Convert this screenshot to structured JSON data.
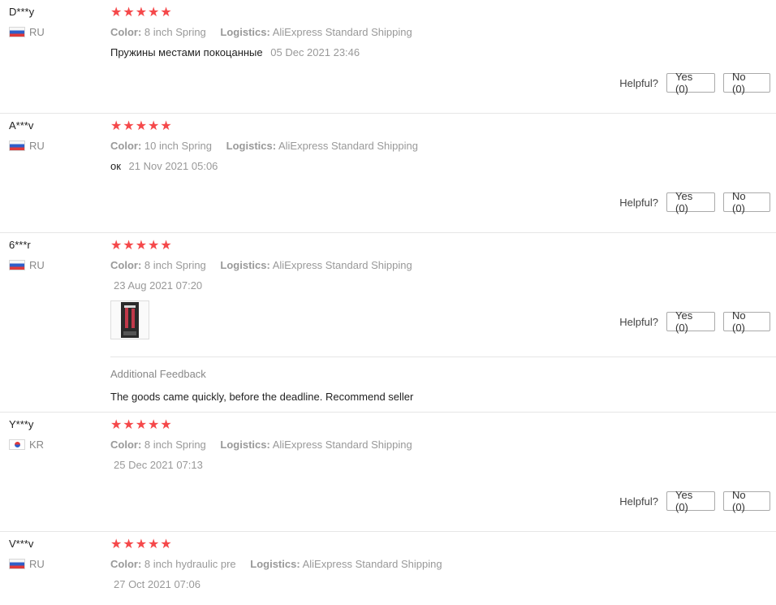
{
  "colors": {
    "star": "#f5484a",
    "divider": "#e6e6e6",
    "muted": "#999999"
  },
  "helpful_label": "Helpful?",
  "color_key": "Color:",
  "logistics_key": "Logistics:",
  "additional_title": "Additional Feedback",
  "reviews": [
    {
      "name": "D***y",
      "country": "RU",
      "rating": 5,
      "color": "8 inch Spring",
      "logistics": "AliExpress Standard Shipping",
      "text": "Пружины местами покоцанные",
      "date": "05 Dec 2021 23:46",
      "yes": "Yes (0)",
      "no": "No (0)"
    },
    {
      "name": "A***v",
      "country": "RU",
      "rating": 5,
      "color": "10 inch Spring",
      "logistics": "AliExpress Standard Shipping",
      "text": "ок",
      "date": "21 Nov 2021 05:06",
      "yes": "Yes (0)",
      "no": "No (0)"
    },
    {
      "name": "6***r",
      "country": "RU",
      "rating": 5,
      "color": "8 inch Spring",
      "logistics": "AliExpress Standard Shipping",
      "text": "",
      "date": "23 Aug 2021 07:20",
      "yes": "Yes (0)",
      "no": "No (0)",
      "additional": "The goods came quickly, before the deadline. Recommend seller"
    },
    {
      "name": "Y***y",
      "country": "KR",
      "rating": 5,
      "color": "8 inch Spring",
      "logistics": "AliExpress Standard Shipping",
      "text": "",
      "date": "25 Dec 2021 07:13",
      "yes": "Yes (0)",
      "no": "No (0)"
    },
    {
      "name": "V***v",
      "country": "RU",
      "rating": 5,
      "color": "8 inch hydraulic pre",
      "logistics": "AliExpress Standard Shipping",
      "text": "",
      "date": "27 Oct 2021 07:06"
    }
  ]
}
